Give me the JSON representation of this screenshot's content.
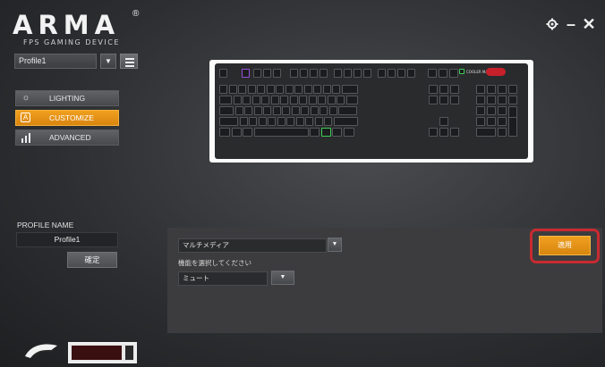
{
  "logo": {
    "wordmark": "ARMA",
    "registered": "®",
    "tagline": "FPS GAMING DEVICE"
  },
  "window": {
    "settings_icon": "gear-icon",
    "minimize_label": "–",
    "close_label": "✕"
  },
  "profile": {
    "selected": "Profile1",
    "dropdown_arrow": "▼",
    "menu_icon": "hamburger-menu-icon"
  },
  "nav": {
    "items": [
      {
        "label": "LIGHTING",
        "icon": "sun-icon",
        "glyph": "☼",
        "active": false
      },
      {
        "label": "CUSTOMIZE",
        "icon": "custom-key-icon",
        "glyph": "A",
        "active": true
      },
      {
        "label": "ADVANCED",
        "icon": "bars-icon",
        "glyph": "",
        "active": false
      }
    ]
  },
  "keyboard": {
    "brand_text": "COOLER MASTER"
  },
  "profile_name": {
    "heading": "PROFILE NAME",
    "value": "Profile1",
    "confirm_label": "確定"
  },
  "function_panel": {
    "category": "マルチメディア",
    "category_arrow": "▼",
    "prompt": "機能を選択してください",
    "function": "ミュート",
    "function_arrow": "▼"
  },
  "apply": {
    "label": "適用"
  },
  "colors": {
    "accent": "#e8961a",
    "highlight_ring": "#c82a30",
    "key_purple": "#9a4fe0",
    "key_green": "#3ed05a"
  }
}
